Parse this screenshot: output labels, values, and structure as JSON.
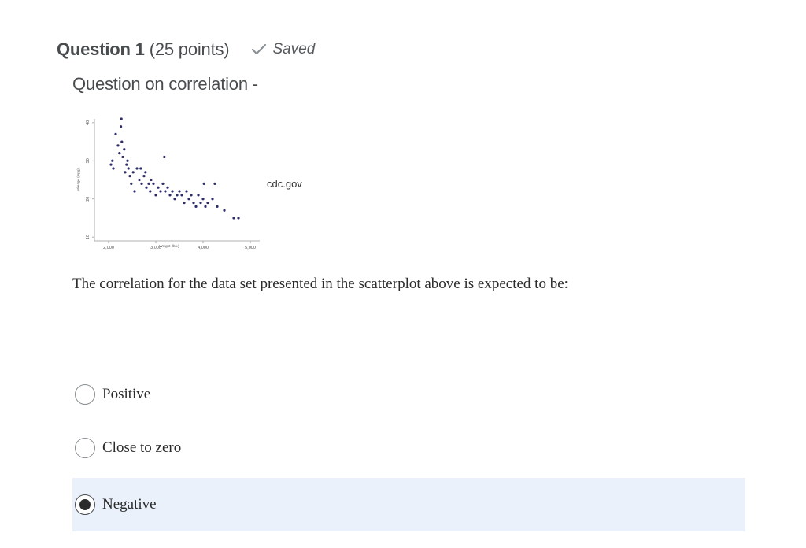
{
  "question": {
    "title": "Question 1",
    "points": "(25 points)",
    "saved_label": "Saved",
    "prompt_title": "Question on correlation -",
    "source": "cdc.gov",
    "text": "The correlation for the data set presented in the scatterplot above is expected to be:"
  },
  "options": [
    {
      "label": "Positive",
      "selected": false
    },
    {
      "label": "Close to zero",
      "selected": false
    },
    {
      "label": "Negative",
      "selected": true
    }
  ],
  "colors": {
    "text": "#494c4e",
    "selected_bg": "#eaf1fb",
    "saved_check": "#8a9094",
    "marker": "#2e2d6b"
  },
  "chart_data": {
    "type": "scatter",
    "xlabel": "Weight (lbs.)",
    "ylabel": "Mileage (mpg)",
    "xlim": [
      1700,
      5200
    ],
    "ylim": [
      9,
      41
    ],
    "xticks": [
      "2,000",
      "3,000",
      "4,000",
      "5,000"
    ],
    "yticks": [
      "10",
      "20",
      "30",
      "40"
    ],
    "x": [
      2050,
      2080,
      2100,
      2150,
      2200,
      2230,
      2260,
      2280,
      2300,
      2330,
      2350,
      2380,
      2400,
      2420,
      2450,
      2480,
      2520,
      2550,
      2600,
      2650,
      2700,
      2750,
      2780,
      2800,
      2850,
      2880,
      2900,
      2950,
      3000,
      3050,
      3100,
      3150,
      3200,
      3250,
      3300,
      3350,
      3400,
      3450,
      3500,
      3550,
      3600,
      3650,
      3700,
      3750,
      3800,
      3850,
      3900,
      3950,
      4000,
      4050,
      4100,
      4200,
      4300,
      4450,
      4650,
      4750,
      2270,
      2680,
      3180,
      4020,
      4250
    ],
    "y": [
      29,
      30,
      28,
      37,
      34,
      32,
      39,
      35,
      31,
      33,
      27,
      29,
      30,
      28,
      26,
      24,
      27,
      22,
      28,
      25,
      24,
      26,
      27,
      23,
      24,
      22,
      25,
      24,
      21,
      23,
      22,
      24,
      22,
      23,
      21,
      22,
      20,
      21,
      22,
      21,
      19,
      22,
      20,
      21,
      19,
      18,
      21,
      19,
      20,
      18,
      19,
      20,
      18,
      17,
      15,
      15,
      41,
      28,
      31,
      24,
      24
    ]
  }
}
